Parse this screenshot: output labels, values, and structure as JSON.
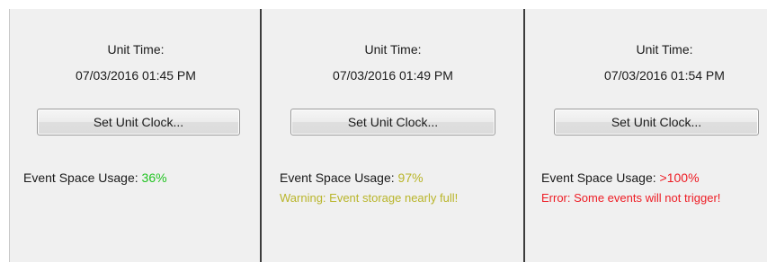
{
  "colors": {
    "ok": "#22c322",
    "warning": "#b9b52a",
    "error": "#ee1c24"
  },
  "panels": [
    {
      "unit_time_label": "Unit Time:",
      "unit_time": "07/03/2016 01:45 PM",
      "set_clock_label": "Set Unit Clock...",
      "usage_label": "Event Space Usage:",
      "usage_value": "36%",
      "usage_fraction": 0.36,
      "status": "ok",
      "message": ""
    },
    {
      "unit_time_label": "Unit Time:",
      "unit_time": "07/03/2016 01:49 PM",
      "set_clock_label": "Set Unit Clock...",
      "usage_label": "Event Space Usage:",
      "usage_value": "97%",
      "usage_fraction": 0.97,
      "status": "warning",
      "message": "Warning: Event storage nearly full!"
    },
    {
      "unit_time_label": "Unit Time:",
      "unit_time": "07/03/2016 01:54 PM",
      "set_clock_label": "Set Unit Clock...",
      "usage_label": "Event Space Usage:",
      "usage_value": ">100%",
      "usage_fraction": 1.0,
      "status": "error",
      "message": "Error: Some events will not trigger!"
    }
  ]
}
